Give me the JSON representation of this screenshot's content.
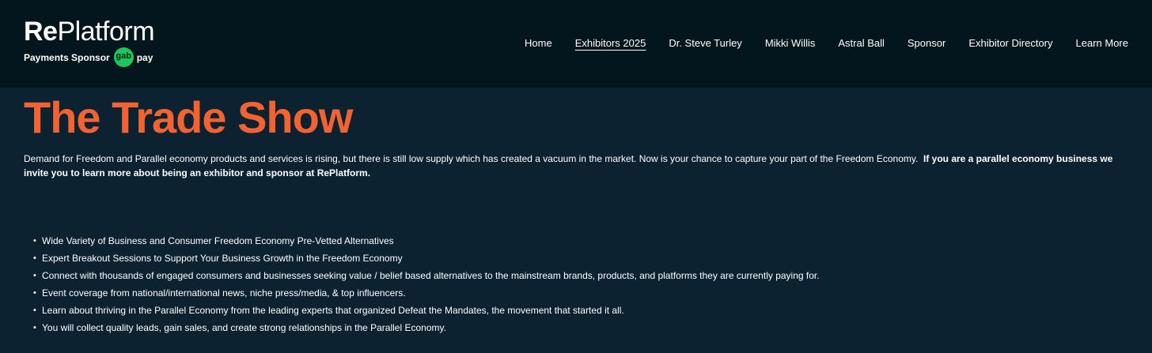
{
  "header": {
    "logo": {
      "re": "Re",
      "platform": "Platform",
      "sponsor_label": "Payments Sponsor",
      "gab_badge": "gab",
      "pay_text": "pay",
      "badge_color": "#21c55d"
    },
    "nav": [
      {
        "label": "Home",
        "active": false
      },
      {
        "label": "Exhibitors 2025",
        "active": true
      },
      {
        "label": "Dr. Steve Turley",
        "active": false
      },
      {
        "label": "Mikki Willis",
        "active": false
      },
      {
        "label": "Astral Ball",
        "active": false
      },
      {
        "label": "Sponsor",
        "active": false
      },
      {
        "label": "Exhibitor Directory",
        "active": false
      },
      {
        "label": "Learn More",
        "active": false
      }
    ]
  },
  "main": {
    "title": "The Trade Show",
    "intro_text": "Demand for Freedom and Parallel economy products and services is rising, but there is still low supply which has created a vacuum in the market. Now is your chance to capture your part of the Freedom Economy.",
    "intro_bold": "If you are a parallel economy business we invite you to learn more about being an exhibitor and sponsor at RePlatform.",
    "features": [
      "Wide Variety of Business and Consumer Freedom Economy Pre-Vetted Alternatives",
      "Expert Breakout Sessions to Support Your Business Growth in the Freedom Economy",
      "Connect with thousands of engaged consumers and businesses seeking value / belief based alternatives to the mainstream brands, products, and platforms they are currently paying for.",
      "Event coverage from national/international news, niche press/media, & top influencers.",
      "Learn about thriving in the Parallel Economy from the leading experts that organized Defeat the Mandates, the movement that started it all.",
      "You will collect quality leads, gain sales, and create strong relationships in the Parallel Economy."
    ]
  },
  "colors": {
    "header_bg": "#04161d",
    "page_bg": "#0d2230",
    "title_accent": "#f26331"
  }
}
